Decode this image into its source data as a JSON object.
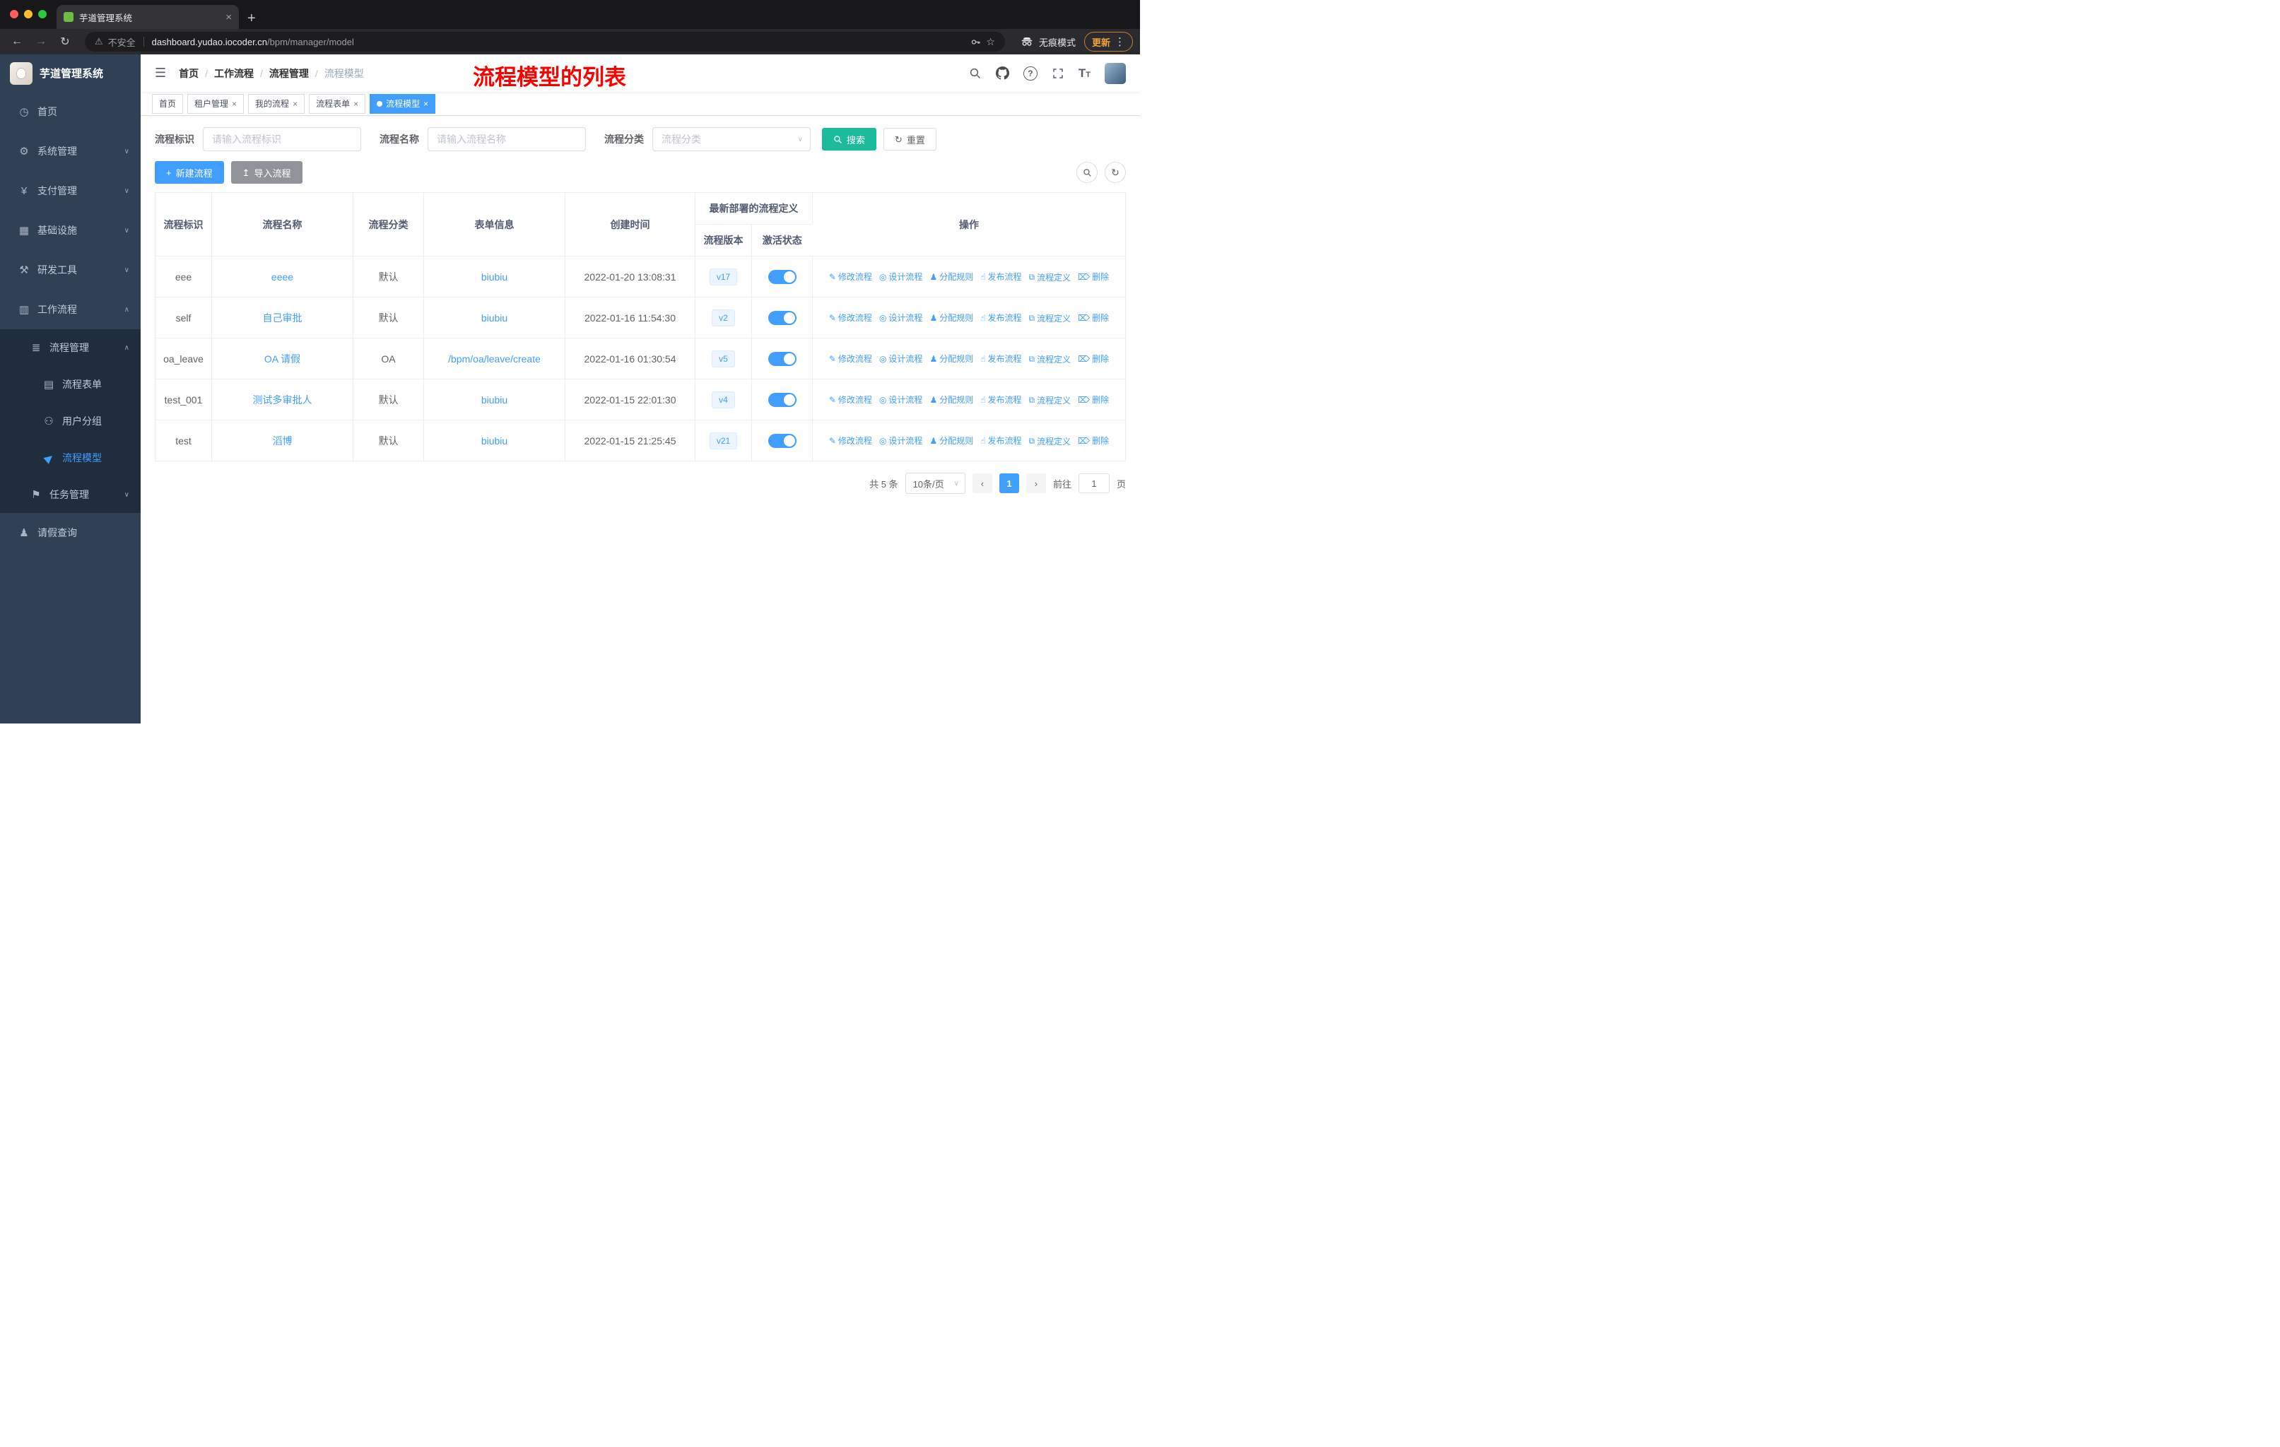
{
  "browser": {
    "tab_title": "芋道管理系统",
    "security_label": "不安全",
    "url_host": "dashboard.yudao.iocoder.cn",
    "url_path": "/bpm/manager/model",
    "incognito_label": "无痕模式",
    "update_label": "更新"
  },
  "sidebar": {
    "logo_title": "芋道管理系统",
    "menu": [
      {
        "label": "首页",
        "icon": "dashboard-icon"
      },
      {
        "label": "系统管理",
        "icon": "gear-icon"
      },
      {
        "label": "支付管理",
        "icon": "yen-icon"
      },
      {
        "label": "基础设施",
        "icon": "infrastructure-icon"
      },
      {
        "label": "研发工具",
        "icon": "tools-icon"
      },
      {
        "label": "工作流程",
        "icon": "workflow-icon",
        "expanded": true
      },
      {
        "label": "流程管理",
        "icon": "process-management-icon",
        "expanded": true
      },
      {
        "label": "流程表单",
        "icon": "form-icon"
      },
      {
        "label": "用户分组",
        "icon": "user-group-icon"
      },
      {
        "label": "流程模型",
        "icon": "paper-plane-icon",
        "active": true
      },
      {
        "label": "任务管理",
        "icon": "task-icon"
      },
      {
        "label": "请假查询",
        "icon": "user-icon"
      }
    ]
  },
  "navbar": {
    "breadcrumb": [
      "首页",
      "工作流程",
      "流程管理",
      "流程模型"
    ],
    "annotation": "流程模型的列表"
  },
  "tags": [
    {
      "label": "首页"
    },
    {
      "label": "租户管理"
    },
    {
      "label": "我的流程"
    },
    {
      "label": "流程表单"
    },
    {
      "label": "流程模型"
    }
  ],
  "filters": {
    "key_label": "流程标识",
    "key_placeholder": "请输入流程标识",
    "name_label": "流程名称",
    "name_placeholder": "请输入流程名称",
    "category_label": "流程分类",
    "category_placeholder": "流程分类",
    "search_label": "搜索",
    "reset_label": "重置"
  },
  "toolbar": {
    "create_label": "新建流程",
    "import_label": "导入流程"
  },
  "table": {
    "headers": {
      "key": "流程标识",
      "name": "流程名称",
      "category": "流程分类",
      "form": "表单信息",
      "created": "创建时间",
      "deploy_group": "最新部署的流程定义",
      "version": "流程版本",
      "state": "激活状态",
      "actions": "操作"
    },
    "action_labels": [
      {
        "label": "修改流程",
        "name": "edit-process",
        "icon": "edit-icon",
        "glyph": "✎"
      },
      {
        "label": "设计流程",
        "name": "design-process",
        "icon": "design-icon",
        "glyph": "◎"
      },
      {
        "label": "分配规则",
        "name": "assign-rule",
        "icon": "assign-user-icon",
        "glyph": "♟"
      },
      {
        "label": "发布流程",
        "name": "publish-process",
        "icon": "publish-icon",
        "glyph": "☝"
      },
      {
        "label": "流程定义",
        "name": "process-definition",
        "icon": "definition-icon",
        "glyph": "⧉"
      },
      {
        "label": "删除",
        "name": "delete-process",
        "icon": "delete-icon",
        "glyph": "⌦"
      }
    ],
    "rows": [
      {
        "key": "eee",
        "name": "eeee",
        "category": "默认",
        "form": "biubiu",
        "created": "2022-01-20 13:08:31",
        "version": "v17",
        "active": true
      },
      {
        "key": "self",
        "name": "自己审批",
        "category": "默认",
        "form": "biubiu",
        "created": "2022-01-16 11:54:30",
        "version": "v2",
        "active": true
      },
      {
        "key": "oa_leave",
        "name": "OA 请假",
        "category": "OA",
        "form": "/bpm/oa/leave/create",
        "created": "2022-01-16 01:30:54",
        "version": "v5",
        "active": true
      },
      {
        "key": "test_001",
        "name": "测试多审批人",
        "category": "默认",
        "form": "biubiu",
        "created": "2022-01-15 22:01:30",
        "version": "v4",
        "active": true
      },
      {
        "key": "test",
        "name": "滔博",
        "category": "默认",
        "form": "biubiu",
        "created": "2022-01-15 21:25:45",
        "version": "v21",
        "active": true
      }
    ]
  },
  "pagination": {
    "total": "共 5 条",
    "page_size": "10条/页",
    "current_page": "1",
    "goto_label": "前往",
    "goto_value": "1",
    "page_unit": "页"
  },
  "colors": {
    "primary": "#409EFF",
    "search_button": "#1ABC9C",
    "sidebar_bg": "#304156",
    "submenu_bg": "#1F2D3D",
    "annotation": "#FF0000",
    "tag_bg": "#ECF5FF",
    "link": "#409EFF"
  }
}
